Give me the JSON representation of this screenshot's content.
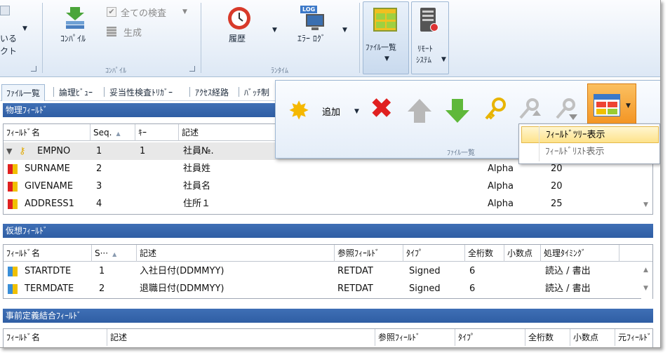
{
  "ribbon": {
    "left_partial_label1": "いる",
    "left_partial_label2": "クト",
    "compile_button": "ｺﾝﾊﾟｲﾙ",
    "check_all": "全ての検査",
    "generate": "生成",
    "compile_group": "ｺﾝﾊﾟｲﾙ",
    "history_button": "履歴",
    "error_log_button": "ｴﾗｰ ﾛｸﾞ",
    "log_badge": "LOG",
    "runtime_group": "ﾗﾝﾀｲﾑ",
    "file_list_button": "ﾌｧｲﾙ一覧",
    "remote_button_line1": "ﾘﾓｰﾄ",
    "remote_button_line2": "ｼｽﾃﾑ"
  },
  "tabs": [
    "ﾌｧｲﾙ一覧",
    "論理ﾋﾞｭｰ",
    "妥当性検査ﾄﾘｶﾞｰ",
    "ｱｸｾｽ経路",
    "ﾊﾞｯﾁ制"
  ],
  "popup": {
    "add_label": "追加",
    "group_label": "ﾌｧｲﾙ一覧"
  },
  "menu": {
    "item_tree": "ﾌｨｰﾙﾄﾞﾂﾘｰ表示",
    "item_list": "ﾌｨｰﾙﾄﾞﾘｽﾄ表示"
  },
  "physical": {
    "title": "物理ﾌｨｰﾙﾄﾞ",
    "headers": [
      "ﾌｨｰﾙﾄﾞ名",
      "Seq.",
      "ｷｰ",
      "記述"
    ],
    "rows": [
      {
        "name": "EMPNO",
        "seq": "1",
        "key": "1",
        "desc": "社員№.",
        "type": "",
        "len": ""
      },
      {
        "name": "SURNAME",
        "seq": "2",
        "key": "",
        "desc": "社員姓",
        "type": "Alpha",
        "len": "20"
      },
      {
        "name": "GIVENAME",
        "seq": "3",
        "key": "",
        "desc": "社員名",
        "type": "Alpha",
        "len": "20"
      },
      {
        "name": "ADDRESS1",
        "seq": "4",
        "key": "",
        "desc": "住所１",
        "type": "Alpha",
        "len": "25"
      }
    ]
  },
  "virtual": {
    "title": "仮想ﾌｨｰﾙﾄﾞ",
    "headers": [
      "ﾌｨｰﾙﾄﾞ名",
      "S···",
      "記述",
      "参照ﾌｨｰﾙﾄﾞ",
      "ﾀｲﾌﾟ",
      "全桁数",
      "小数点",
      "処理ﾀｲﾐﾝｸﾞ"
    ],
    "rows": [
      {
        "name": "STARTDTE",
        "seq": "1",
        "desc": "入社日付(DDMMYY)",
        "ref": "RETDAT",
        "type": "Signed",
        "digits": "6",
        "timing": "読込 / 書出"
      },
      {
        "name": "TERMDATE",
        "seq": "2",
        "desc": "退職日付(DDMMYY)",
        "ref": "RETDAT",
        "type": "Signed",
        "digits": "6",
        "timing": "読込 / 書出"
      }
    ]
  },
  "predefined": {
    "title": "事前定義結合ﾌｨｰﾙﾄﾞ",
    "headers": [
      "ﾌｨｰﾙﾄﾞ名",
      "記述",
      "参照ﾌｨｰﾙﾄﾞ",
      "ﾀｲﾌﾟ",
      "全桁数",
      "小数点",
      "元ﾌｨｰﾙﾄﾞ"
    ]
  }
}
